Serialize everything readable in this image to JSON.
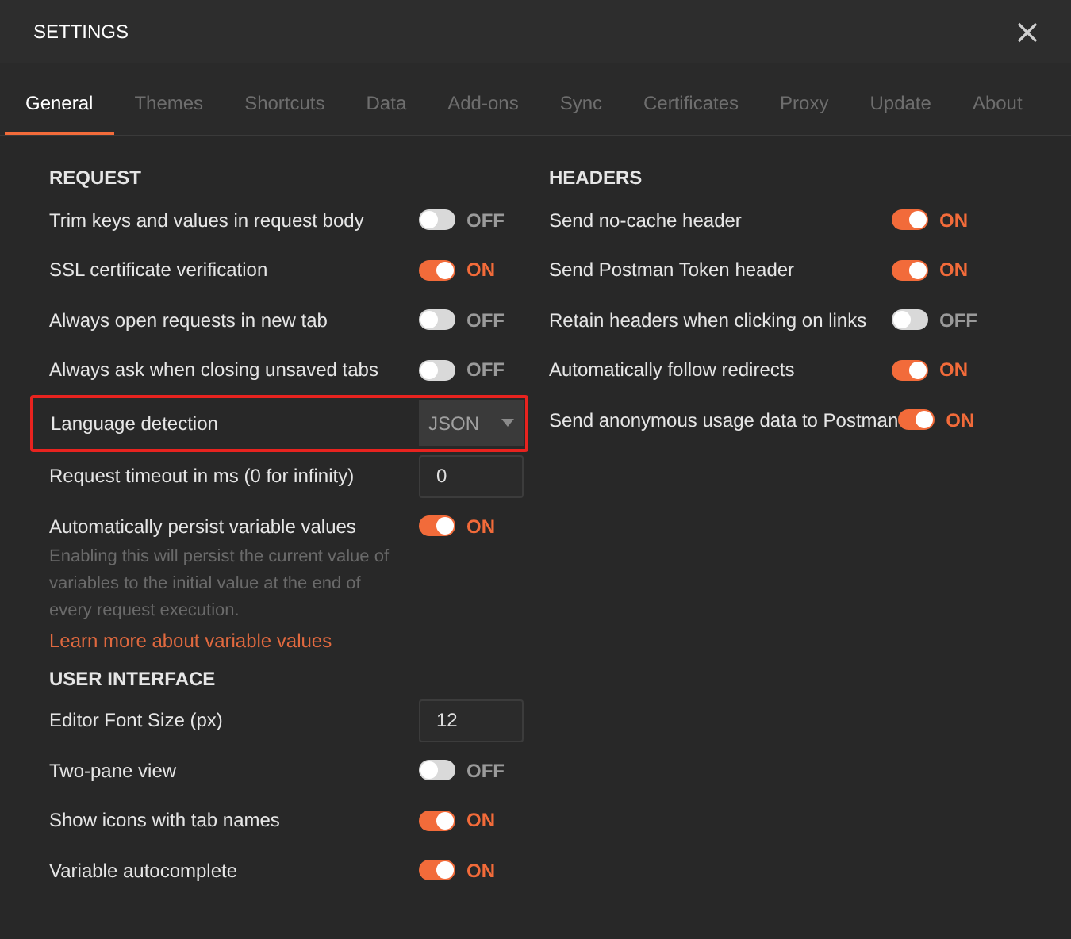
{
  "window": {
    "title": "SETTINGS"
  },
  "tabs": [
    {
      "label": "General",
      "selected": true
    },
    {
      "label": "Themes",
      "selected": false
    },
    {
      "label": "Shortcuts",
      "selected": false
    },
    {
      "label": "Data",
      "selected": false
    },
    {
      "label": "Add-ons",
      "selected": false
    },
    {
      "label": "Sync",
      "selected": false
    },
    {
      "label": "Certificates",
      "selected": false
    },
    {
      "label": "Proxy",
      "selected": false
    },
    {
      "label": "Update",
      "selected": false
    },
    {
      "label": "About",
      "selected": false
    }
  ],
  "left_column": [
    {
      "heading": "REQUEST",
      "rows": [
        {
          "kind": "toggle",
          "label": "Trim keys and values in request body",
          "on": false,
          "state_text": "OFF"
        },
        {
          "kind": "toggle",
          "label": "SSL certificate verification",
          "on": true,
          "state_text": "ON"
        },
        {
          "kind": "toggle",
          "label": "Always open requests in new tab",
          "on": false,
          "state_text": "OFF"
        },
        {
          "kind": "toggle",
          "label": "Always ask when closing unsaved tabs",
          "on": false,
          "state_text": "OFF"
        },
        {
          "kind": "select",
          "label": "Language detection",
          "value": "JSON",
          "highlighted": true
        },
        {
          "kind": "number",
          "label": "Request timeout in ms (0 for infinity)",
          "value": "0"
        },
        {
          "kind": "toggle",
          "label": "Automatically persist variable values",
          "on": true,
          "state_text": "ON",
          "help": "Enabling this will persist the current value of variables to the initial value at the end of every request execution.",
          "link": "Learn more about variable values"
        }
      ]
    },
    {
      "heading": "USER INTERFACE",
      "rows": [
        {
          "kind": "number",
          "label": "Editor Font Size (px)",
          "value": "12"
        },
        {
          "kind": "toggle",
          "label": "Two-pane view",
          "on": false,
          "state_text": "OFF"
        },
        {
          "kind": "toggle",
          "label": "Show icons with tab names",
          "on": true,
          "state_text": "ON"
        },
        {
          "kind": "toggle",
          "label": "Variable autocomplete",
          "on": true,
          "state_text": "ON"
        }
      ]
    }
  ],
  "right_column": [
    {
      "heading": "HEADERS",
      "rows": [
        {
          "kind": "toggle",
          "label": "Send no-cache header",
          "on": true,
          "state_text": "ON"
        },
        {
          "kind": "toggle",
          "label": "Send Postman Token header",
          "on": true,
          "state_text": "ON"
        },
        {
          "kind": "toggle",
          "label": "Retain headers when clicking on links",
          "on": false,
          "state_text": "OFF"
        },
        {
          "kind": "toggle",
          "label": "Automatically follow redirects",
          "on": true,
          "state_text": "ON"
        },
        {
          "kind": "toggle",
          "label": "Send anonymous usage data to Postman",
          "on": true,
          "state_text": "ON"
        }
      ]
    }
  ]
}
